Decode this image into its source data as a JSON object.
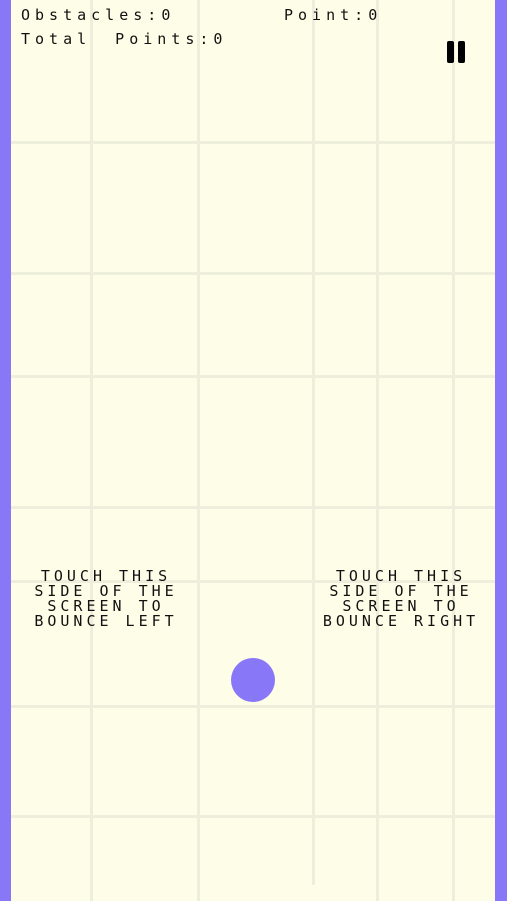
{
  "hud": {
    "obstacles_label": "Obstacles:",
    "obstacles_value": "0",
    "point_label": "Point:",
    "point_value": "0",
    "total_points_label": "Total Points:",
    "total_points_value": "0"
  },
  "hints": {
    "left": [
      "TOUCH THIS",
      "SIDE OF THE",
      "SCREEN TO",
      "BOUNCE LEFT"
    ],
    "right": [
      "TOUCH THIS",
      "SIDE OF THE",
      "SCREEN TO",
      "BOUNCE RIGHT"
    ]
  },
  "icons": {
    "pause": "pause-icon"
  },
  "colors": {
    "background": "#fefee8",
    "walls": "#8878f8",
    "ball": "#8878f8",
    "grid": "#eeeedc",
    "text": "#111111"
  }
}
